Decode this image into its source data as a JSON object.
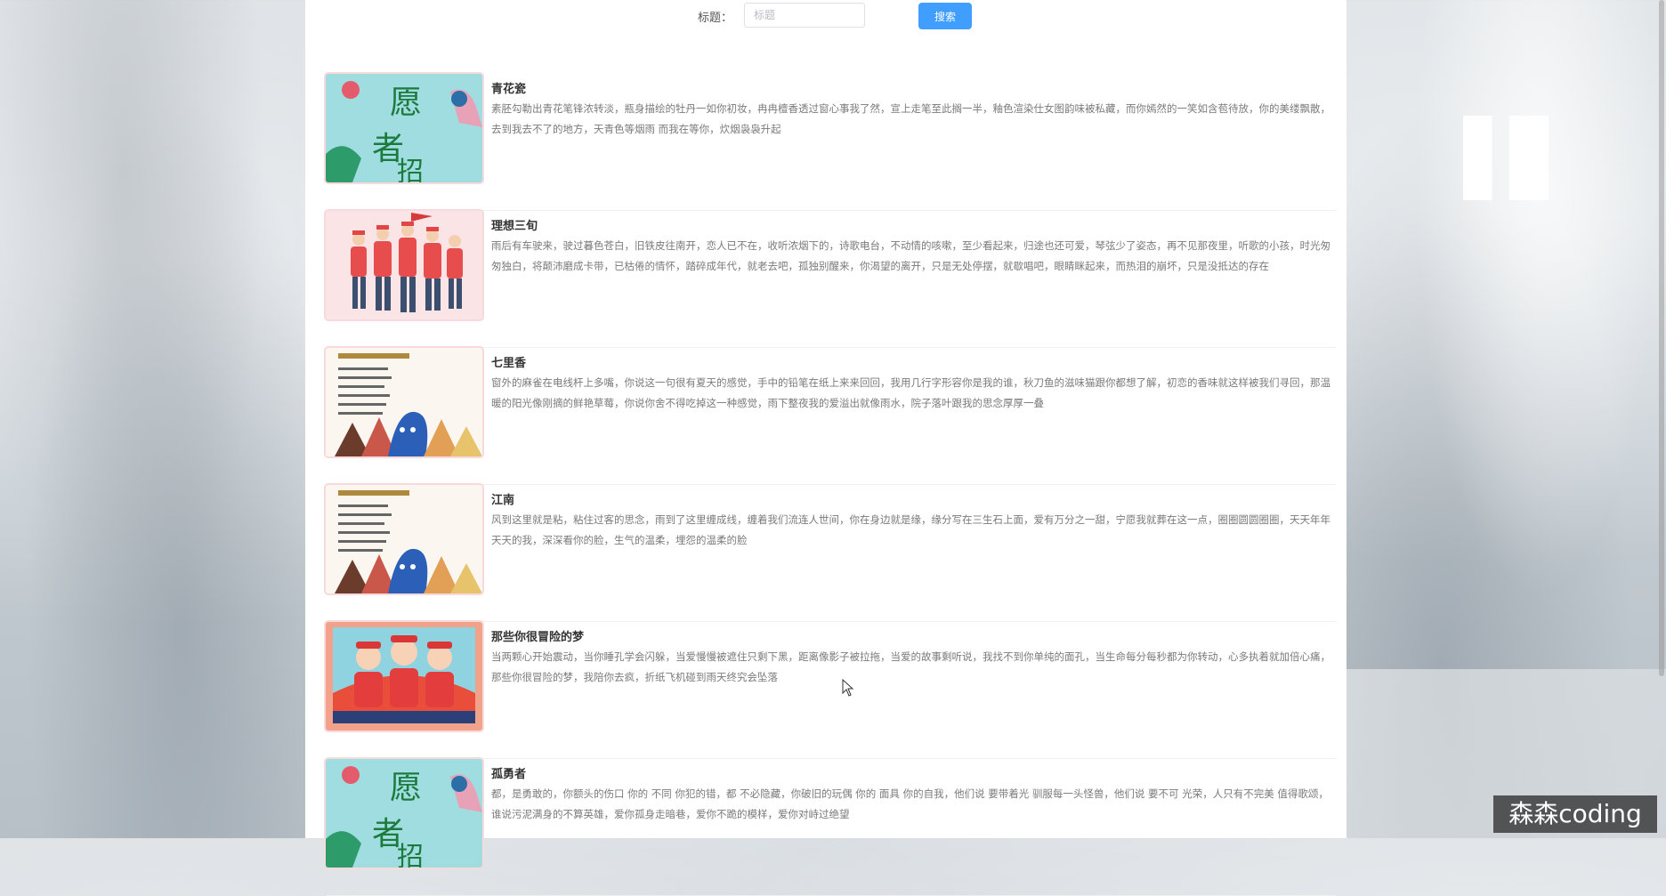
{
  "search": {
    "label": "标题：",
    "placeholder": "标题",
    "value": "",
    "button_label": "搜索"
  },
  "articles": [
    {
      "title": "青花瓷",
      "summary": "素胚勾勒出青花笔锋浓转淡，瓶身描绘的牡丹一如你初妆，冉冉檀香透过窗心事我了然，宣上走笔至此搁一半，釉色渲染仕女图韵味被私藏，而你嫣然的一笑如含苞待放，你的美缕飘散，去到我去不了的地方，天青色等烟雨 而我在等你，炊烟袅袅升起",
      "image": "volunteer-poster"
    },
    {
      "title": "理想三旬",
      "summary": "雨后有车驶来，驶过暮色苍白，旧铁皮往南开，恋人已不在，收听浓烟下的，诗歌电台，不动情的咳嗽，至少看起来，归途也还可爱，琴弦少了姿态，再不见那夜里，听歌的小孩，时光匆匆独白，将颠沛磨成卡带，已枯倦的情怀，踏碎成年代，就老去吧，孤独别醒来，你渴望的离开，只是无处停摆，就歇唱吧，眼睛眯起来，而热泪的崩坏，只是没抵达的存在",
      "image": "volunteer-group"
    },
    {
      "title": "七里香",
      "summary": "窗外的麻雀在电线杆上多嘴，你说这一句很有夏天的感觉，手中的铅笔在纸上来来回回，我用几行字形容你是我的谁，秋刀鱼的滋味猫跟你都想了解，初恋的香味就这样被我们寻回，那温暖的阳光像刚摘的鲜艳草莓，你说你舍不得吃掉这一种感觉，雨下整夜我的爱溢出就像雨水，院子落叶跟我的思念厚厚一叠",
      "image": "volunteer-hands"
    },
    {
      "title": "江南",
      "summary": "风到这里就是粘，粘住过客的思念，雨到了这里缠成线，缠着我们流连人世间，你在身边就是缘，缘分写在三生石上面，爱有万分之一甜，宁愿我就葬在这一点，圈圈圆圆圈圈，天天年年天天的我，深深看你的脸，生气的温柔，埋怨的温柔的脸",
      "image": "volunteer-hands"
    },
    {
      "title": "那些你很冒险的梦",
      "summary": "当两颗心开始震动，当你睡孔学会闪躲，当爱慢慢被遮住只剩下黑，距离像影子被拉拖，当爱的故事剩听说，我找不到你单纯的面孔，当生命每分每秒都为你转动，心多执着就加倍心痛，那些你很冒险的梦，我陪你去疯，折纸飞机碰到雨天终究会坠落",
      "image": "volunteer-kids"
    },
    {
      "title": "孤勇者",
      "summary": "都，是勇敢的，你额头的伤口 你的 不同 你犯的错，都 不必隐藏，你破旧的玩偶 你的 面具 你的自我，他们说 要带着光 驯服每一头怪兽，他们说 要不可 光荣，人只有不完美 值得歌颂，谁说污泥满身的不算英雄，爱你孤身走暗巷，爱你不跪的模样，爱你对峙过绝望",
      "image": "volunteer-poster"
    }
  ],
  "watermark": "森森coding"
}
